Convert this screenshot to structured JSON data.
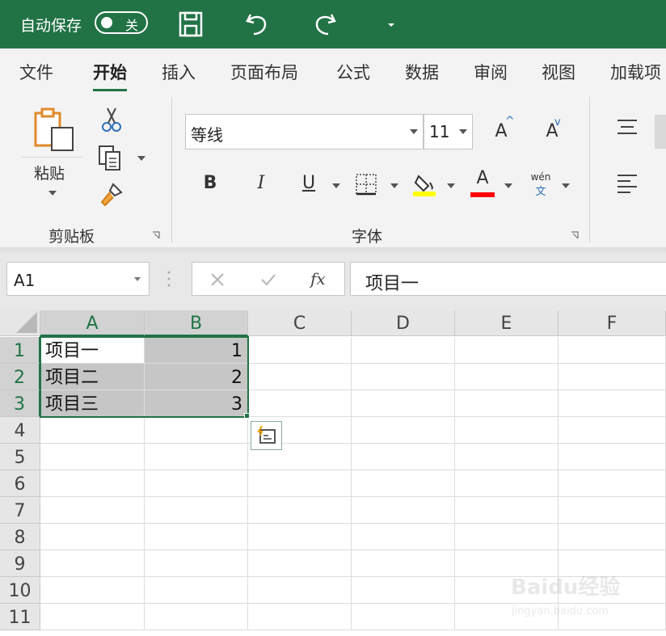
{
  "titlebar": {
    "autosave_label": "自动保存",
    "toggle_state": "关"
  },
  "tabs": [
    "文件",
    "开始",
    "插入",
    "页面布局",
    "公式",
    "数据",
    "审阅",
    "视图",
    "加载项"
  ],
  "ribbon": {
    "clipboard": {
      "paste_label": "粘贴",
      "group_label": "剪贴板"
    },
    "font": {
      "font_name": "等线",
      "font_size": "11",
      "group_label": "字体",
      "bold": "B",
      "italic": "I",
      "underline": "U",
      "font_color_letter": "A",
      "phonetic_top": "wén",
      "phonetic_bottom": "文",
      "grow_letter": "A",
      "shrink_letter": "A",
      "fill_color": "#ffff00",
      "font_color": "#ff0000"
    }
  },
  "formula_bar": {
    "name_box": "A1",
    "fx_label": "fx",
    "content": "项目一"
  },
  "sheet": {
    "columns": [
      "A",
      "B",
      "C",
      "D",
      "E",
      "F"
    ],
    "rows": [
      "1",
      "2",
      "3",
      "4",
      "5",
      "6",
      "7",
      "8",
      "9",
      "10",
      "11"
    ],
    "cells": {
      "A1": "项目一",
      "A2": "项目二",
      "A3": "项目三",
      "B1": "1",
      "B2": "2",
      "B3": "3"
    },
    "accent": "#217346"
  },
  "watermark": {
    "main": "Baidu经验",
    "sub": "jingyan.baidu.com"
  }
}
